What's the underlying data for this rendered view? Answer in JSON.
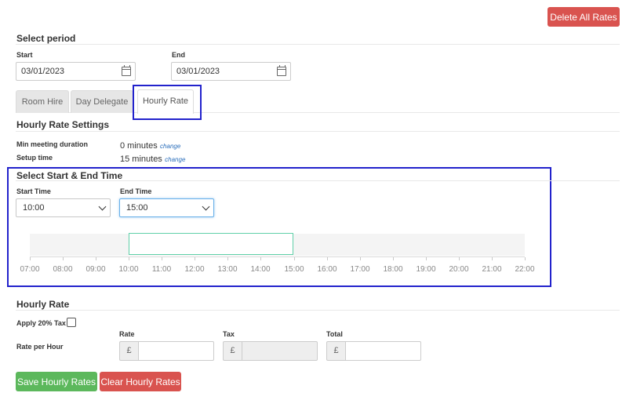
{
  "header": {
    "delete_all_label": "Delete All Rates"
  },
  "period": {
    "title": "Select period",
    "start_label": "Start",
    "start_value": "03/01/2023",
    "end_label": "End",
    "end_value": "03/01/2023"
  },
  "tabs": [
    {
      "label": "Room Hire",
      "active": false
    },
    {
      "label": "Day Delegate",
      "active": false
    },
    {
      "label": "Hourly Rate",
      "active": true
    }
  ],
  "settings": {
    "title": "Hourly Rate Settings",
    "min_label": "Min meeting duration",
    "min_value": "0 minutes",
    "min_change": "change",
    "setup_label": "Setup time",
    "setup_value": "15 minutes",
    "setup_change": "change"
  },
  "time_select": {
    "title": "Select Start & End Time",
    "start_label": "Start Time",
    "start_value": "10:00",
    "end_label": "End Time",
    "end_value": "15:00"
  },
  "timeline": {
    "hours": [
      "07:00",
      "08:00",
      "09:00",
      "10:00",
      "11:00",
      "12:00",
      "13:00",
      "14:00",
      "15:00",
      "16:00",
      "17:00",
      "18:00",
      "19:00",
      "20:00",
      "21:00",
      "22:00"
    ],
    "range_start": "10:00",
    "range_end": "15:00",
    "range_color": "#5fd0a8"
  },
  "hourly_rate": {
    "title": "Hourly Rate",
    "tax_label": "Apply 20% Tax",
    "tax_checked": false,
    "rate_per_hour_label": "Rate per Hour",
    "rate_col": "Rate",
    "tax_col": "Tax",
    "total_col": "Total",
    "currency": "£",
    "rate_value": "",
    "tax_value": "",
    "total_value": ""
  },
  "actions": {
    "save_label": "Save Hourly Rates",
    "clear_label": "Clear Hourly Rates"
  },
  "colors": {
    "danger": "#d9534f",
    "success": "#5cb85c",
    "highlight": "#2222cc",
    "link": "#2a6ebb"
  }
}
